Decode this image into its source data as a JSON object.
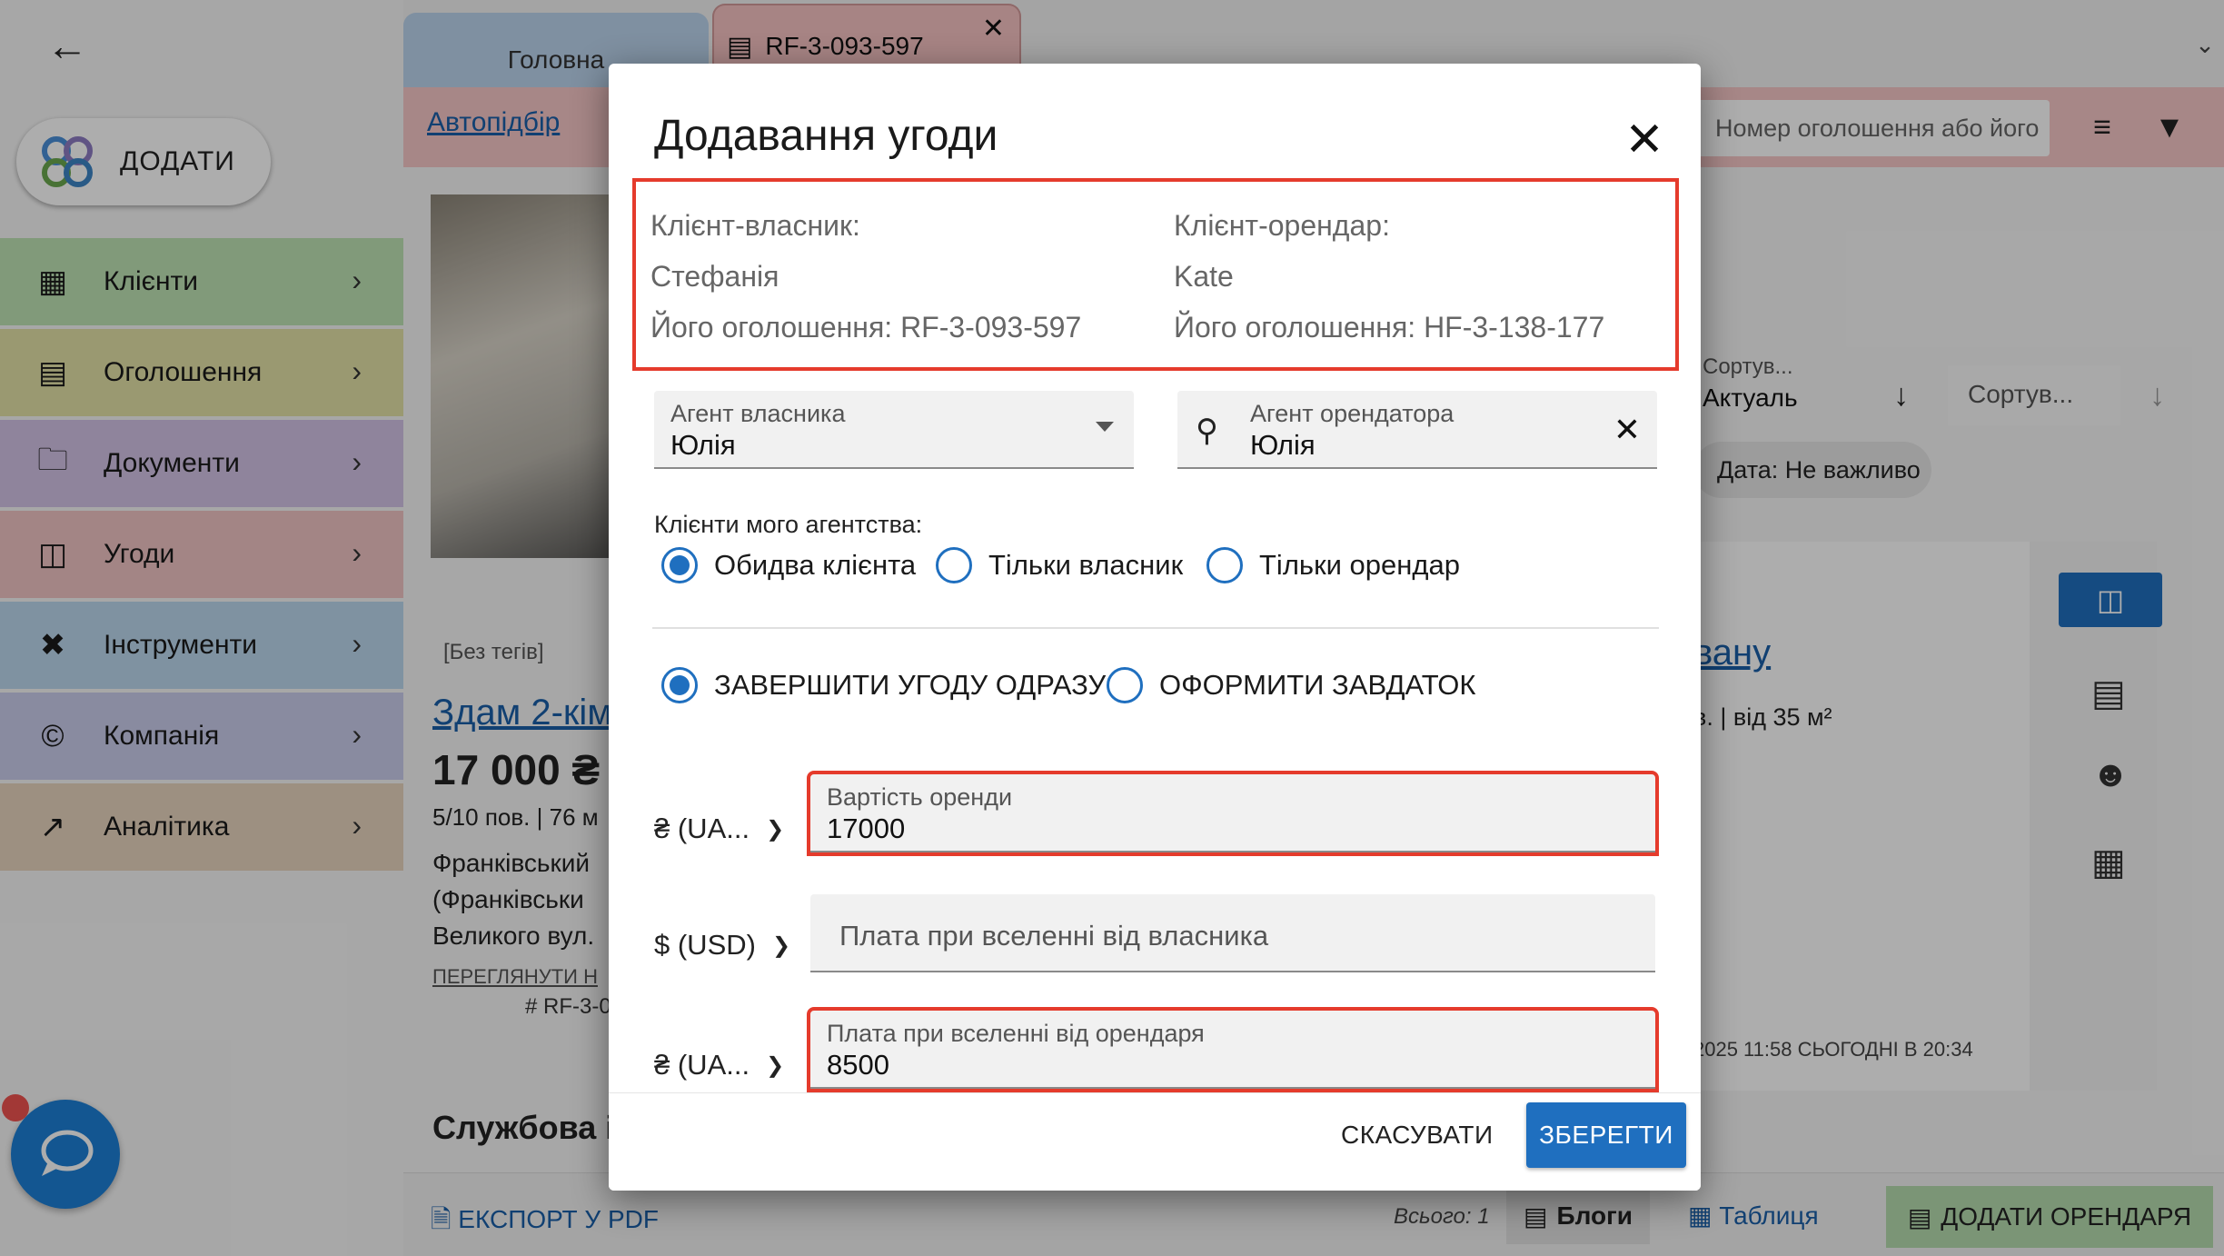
{
  "sidebar": {
    "add_label": "ДОДАТИ",
    "items": [
      {
        "label": "Клієнти",
        "color": "#bfe3b4",
        "icon": "clients-icon"
      },
      {
        "label": "Оголошення",
        "color": "#e3e2a7",
        "icon": "listings-icon"
      },
      {
        "label": "Документи",
        "color": "#d3c3e6",
        "icon": "folder-icon"
      },
      {
        "label": "Угоди",
        "color": "#f0c4c4",
        "icon": "deals-icon"
      },
      {
        "label": "Інструменти",
        "color": "#bcd7ee",
        "icon": "tools-icon"
      },
      {
        "label": "Компанія",
        "color": "#cbcdec",
        "icon": "copyright-icon"
      },
      {
        "label": "Аналітика",
        "color": "#e7d5bf",
        "icon": "analytics-icon"
      }
    ]
  },
  "tabs": {
    "home": "Головна",
    "active": "RF-3-093-597"
  },
  "subbar": {
    "autopick": "Автопідбір",
    "search_placeholder": "Номер оголошення або його"
  },
  "background": {
    "tags": "[Без тегів]",
    "title": "Здам 2-кім",
    "price": "17 000 ₴",
    "meta": "5/10 пов. | 76 м",
    "addr1": "Франківський",
    "addr2": "(Франківськи",
    "addr3": "Великого вул.",
    "view_link": "ПЕРЕГЛЯНУТИ Н",
    "number": "# RF-3-0",
    "service": "Службова ін",
    "sort1_label": "Сортув...",
    "sort1_value": "Актуаль",
    "sort2_label": "Сортув...",
    "date_chip": "Дата: Не важливо",
    "right_link": "вану",
    "right_meta": "в. | від 35 м²",
    "right_dates": "2025 11:58     СЬОГОДНІ В 20:34"
  },
  "footer": {
    "export": "ЕКСПОРТ У PDF",
    "total": "Всього: 1",
    "blogs": "Блоги",
    "table": "Таблиця",
    "add_tenant": "ДОДАТИ ОРЕНДАРЯ"
  },
  "dialog": {
    "title": "Додавання угоди",
    "owner_client_label": "Клієнт-власник:",
    "owner_client_name": "Стефанія",
    "owner_listing": "Його оголошення: RF-3-093-597",
    "tenant_client_label": "Клієнт-орендар:",
    "tenant_client_name": "Kate",
    "tenant_listing": "Його оголошення: HF-3-138-177",
    "owner_agent_label": "Агент власника",
    "owner_agent_value": "Юлія",
    "tenant_agent_label": "Агент орендатора",
    "tenant_agent_value": "Юлія",
    "my_agency_label": "Клієнти мого агентства:",
    "radio_both": "Обидва клієнта",
    "radio_owner": "Тільки власник",
    "radio_tenant": "Тільки орендар",
    "radio_complete": "ЗАВЕРШИТИ УГОДУ ОДРАЗУ",
    "radio_deposit": "ОФОРМИТИ ЗАВДАТОК",
    "currency1": "₴ (UA...",
    "currency2": "$ (USD)",
    "currency3": "₴ (UA...",
    "rent_label": "Вартість оренди",
    "rent_value": "17000",
    "owner_fee_placeholder": "Плата при вселенні від власника",
    "tenant_fee_label": "Плата при вселенні від орендаря",
    "tenant_fee_value": "8500",
    "cancel": "СКАСУВАТИ",
    "save": "ЗБЕРЕГТИ"
  },
  "colors": {
    "accent": "#1f6fbf",
    "highlight": "#e53b2c"
  }
}
